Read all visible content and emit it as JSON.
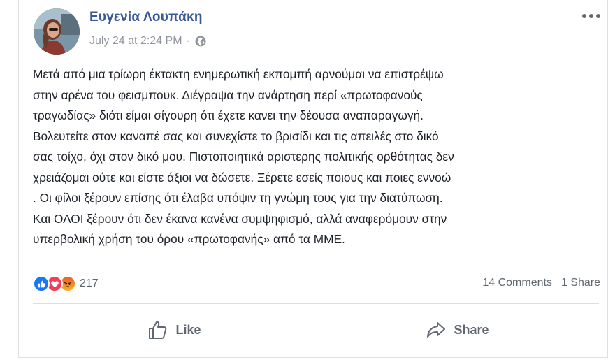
{
  "post": {
    "author": "Ευγενία Λουπάκη",
    "timestamp": "July 24 at 2:24 PM",
    "separator": "·",
    "privacy_icon": "globe-icon",
    "more_icon": "more-horizontal-icon",
    "body_lines": [
      "Μετά από μια τρίωρη έκτακτη ενημερωτική εκπομπή αρνούμαι να επιστρέψω",
      "στην αρένα του φεισμπουκ. Διέγραψα την ανάρτηση περί «πρωτοφανούς",
      "τραγωδίας» διότι είμαι σίγουρη ότι έχετε κανει την δέουσα αναπαραγωγή.",
      "Βολευτείτε στον καναπέ σας και συνεχίστε το βρισίδι και τις απειλές στο δικό",
      "σας τοίχο, όχι στον δικό μου. Πιστοποιητικά αριστερης πολιτικής ορθότητας δεν",
      "χρειάζομαι ούτε και είστε άξιοι να δώσετε. Ξέρετε εσείς ποιους και ποιες εννοώ",
      ". Οι φίλοι ξέρουν επίσης ότι έλαβα υπόψιν τη γνώμη τους για την διατύπωση.",
      "Και ΟΛΟΙ ξέρουν ότι δεν έκανα κανένα συμψηφισμό, αλλά αναφερόμουν στην",
      "υπερβολική χρήση του όρου «πρωτοφανής» από τα ΜΜΕ."
    ]
  },
  "reactions": {
    "icons": [
      "like-reaction-icon",
      "love-reaction-icon",
      "angry-reaction-icon"
    ],
    "colors": {
      "like": "#1877f2",
      "love": "#f33e58",
      "angry": "#f7b125"
    },
    "count": "217"
  },
  "stats": {
    "comments": "14 Comments",
    "shares": "1 Share"
  },
  "actions": {
    "like_label": "Like",
    "share_label": "Share"
  },
  "colors": {
    "author": "#385898",
    "meta": "#90949c",
    "text": "#1d2129",
    "muted": "#606770"
  }
}
